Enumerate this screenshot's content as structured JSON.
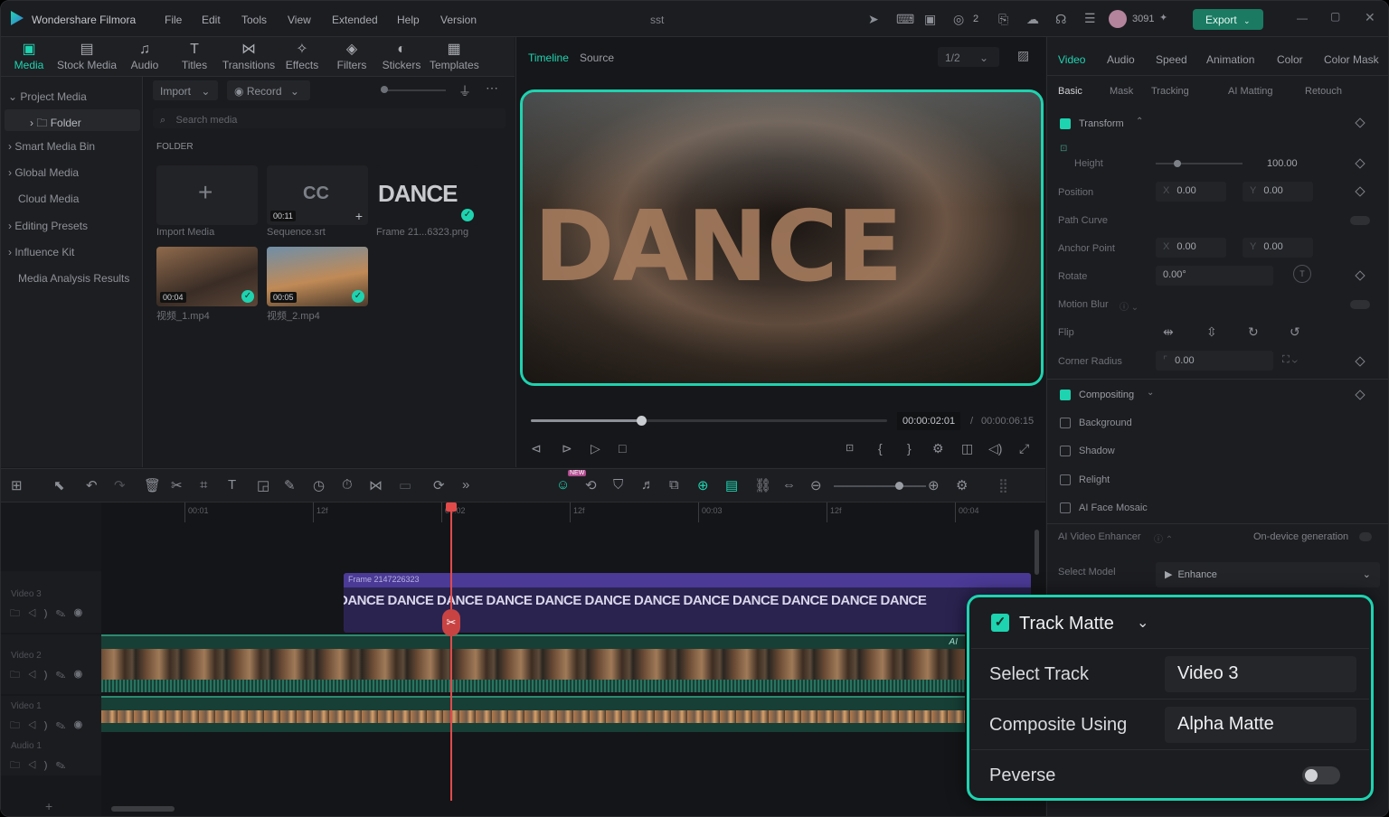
{
  "app": {
    "name": "Wondershare Filmora",
    "project": "sst",
    "coins": "3091",
    "badge_count": "2"
  },
  "menu": [
    "File",
    "Edit",
    "Tools",
    "View",
    "Extended",
    "Help",
    "Version"
  ],
  "export_label": "Export",
  "top_tabs": [
    {
      "label": "Media",
      "icon": "media-icon"
    },
    {
      "label": "Stock Media",
      "icon": "stock-media-icon"
    },
    {
      "label": "Audio",
      "icon": "audio-icon"
    },
    {
      "label": "Titles",
      "icon": "titles-icon"
    },
    {
      "label": "Transitions",
      "icon": "transitions-icon"
    },
    {
      "label": "Effects",
      "icon": "effects-icon"
    },
    {
      "label": "Filters",
      "icon": "filters-icon"
    },
    {
      "label": "Stickers",
      "icon": "stickers-icon"
    },
    {
      "label": "Templates",
      "icon": "templates-icon"
    }
  ],
  "sidebar": {
    "items": [
      "Project Media",
      "Folder",
      "Smart Media Bin",
      "Global Media",
      "Cloud Media",
      "Editing Presets",
      "Influence Kit",
      "Media Analysis Results"
    ]
  },
  "media": {
    "import_label": "Import",
    "record_label": "Record",
    "search_placeholder": "Search media",
    "folder_heading": "FOLDER",
    "items": [
      {
        "caption": "Import Media"
      },
      {
        "caption": "Sequence.srt",
        "duration": "00:11",
        "glyph": "CC"
      },
      {
        "caption": "Frame 21...6323.png",
        "glyph": "DANCE"
      },
      {
        "caption": "视频_1.mp4",
        "duration": "00:04"
      },
      {
        "caption": "视频_2.mp4",
        "duration": "00:05"
      }
    ]
  },
  "preview": {
    "tab_timeline": "Timeline",
    "tab_source": "Source",
    "quality": "1/2",
    "overlay_text": "DANCE",
    "current_time": "00:00:02:01",
    "sep": "/",
    "total_time": "00:00:06:15",
    "progress": 0.31
  },
  "right": {
    "tabs": [
      "Video",
      "Audio",
      "Speed",
      "Animation",
      "Color",
      "Color Mask"
    ],
    "subtabs": [
      "Basic",
      "Mask",
      "Tracking",
      "AI Matting",
      "Retouch"
    ],
    "transform_label": "Transform",
    "height_label": "Height",
    "height_value": "100.00",
    "position_label": "Position",
    "pos_x_label": "X",
    "pos_x": "0.00",
    "pos_y_label": "Y",
    "pos_y": "0.00",
    "path_curve_label": "Path Curve",
    "anchor_label": "Anchor Point",
    "anc_x": "0.00",
    "anc_y": "0.00",
    "rotate_label": "Rotate",
    "rotate_value": "0.00°",
    "motion_blur_label": "Motion Blur",
    "flip_label": "Flip",
    "corner_label": "Corner Radius",
    "corner_value": "0.00",
    "compositing_label": "Compositing",
    "background_label": "Background",
    "shadow_label": "Shadow",
    "relight_label": "Relight",
    "face_mosaic_label": "AI Face Mosaic",
    "enhancer_label": "AI Video Enhancer",
    "on_device_label": "On-device generation",
    "select_model_label": "Select Model",
    "model_value": "Enhance"
  },
  "timeline": {
    "ruler": [
      "00:01",
      "12f",
      "00:02",
      "12f",
      "00:03",
      "12f",
      "00:04"
    ],
    "tracks": [
      {
        "label": "Video 3"
      },
      {
        "label": "Video 2"
      },
      {
        "label": "Video 1"
      },
      {
        "label": "Audio 1"
      }
    ],
    "title_clip_name": "Frame 2147226323",
    "title_clip_text": "DANCE DANCE DANCE DANCE DANCE DANCE DANCE DANCE DANCE DANCE DANCE DANCE",
    "ai_badge": "AI",
    "new_badge": "NEW"
  },
  "popup": {
    "title": "Track Matte",
    "select_track_label": "Select Track",
    "select_track_value": "Video 3",
    "composite_label": "Composite Using",
    "composite_value": "Alpha Matte",
    "reverse_label": "Peverse"
  },
  "colors": {
    "accent": "#1ed3b0",
    "playhead": "#e24a4a",
    "title_clip": "#3a2d6b",
    "video_clip": "#1f6f5b"
  }
}
